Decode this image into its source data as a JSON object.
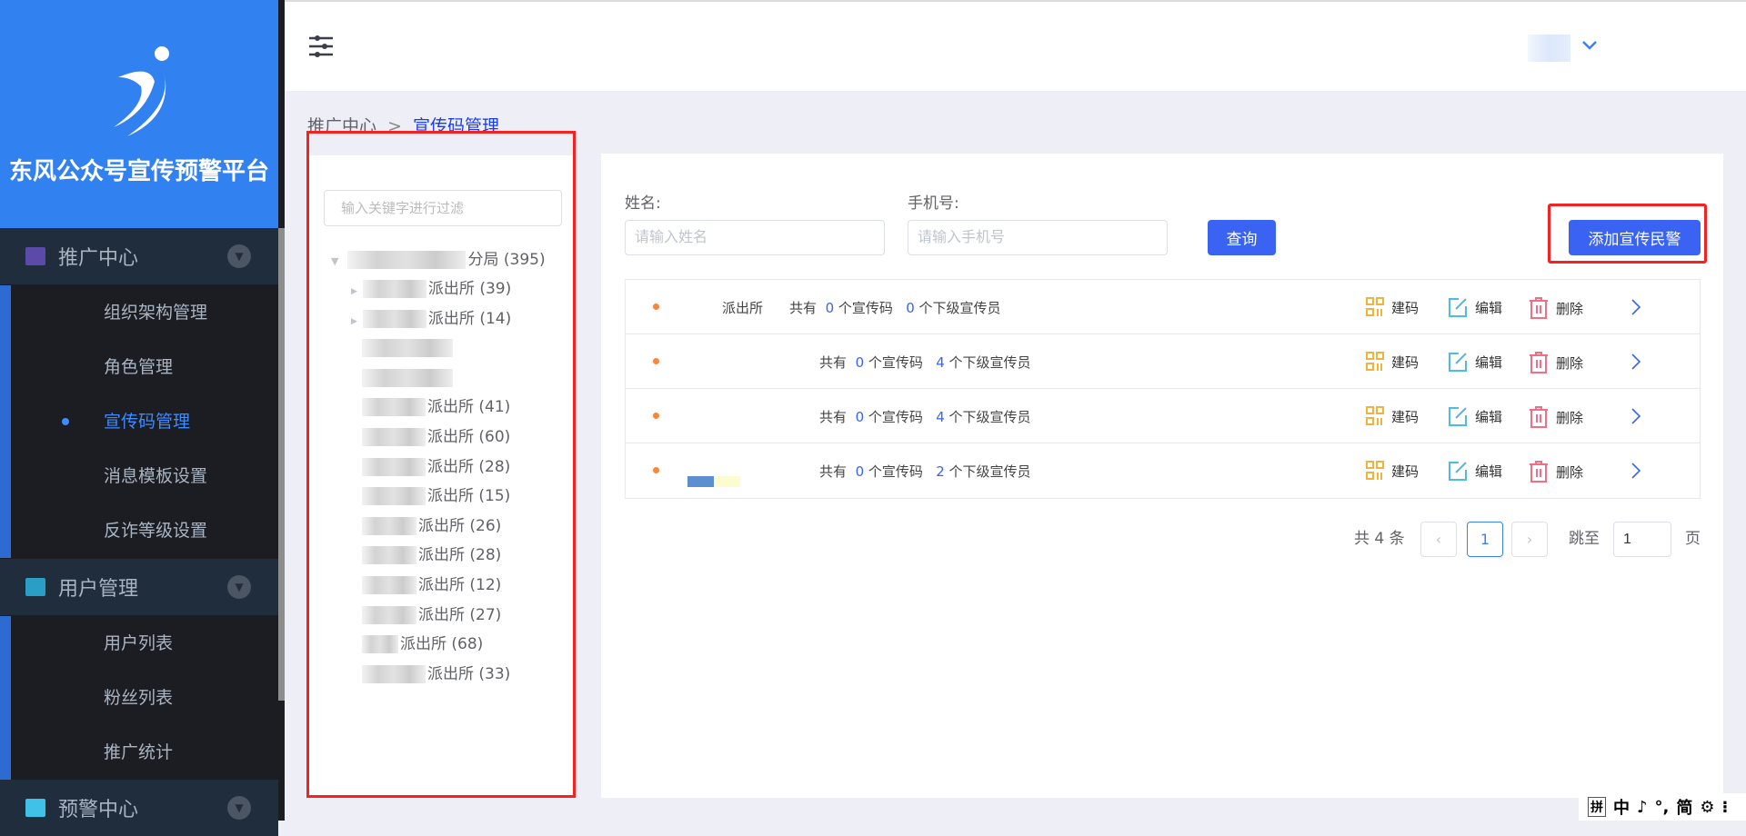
{
  "app": {
    "title": "东风公众号宣传预警平台"
  },
  "sidebar": {
    "groups": [
      {
        "label": "推广中心",
        "items": [
          "组织架构管理",
          "角色管理",
          "宣传码管理",
          "消息模板设置",
          "反诈等级设置"
        ],
        "active": 2
      },
      {
        "label": "用户管理",
        "items": [
          "用户列表",
          "粉丝列表",
          "推广统计"
        ]
      },
      {
        "label": "预警中心",
        "items": []
      }
    ]
  },
  "breadcrumb": {
    "parent": "推广中心",
    "separator": ">",
    "current": "宣传码管理"
  },
  "tree": {
    "filter_placeholder": "输入关键字进行过滤",
    "root": "分局 (395)",
    "children": [
      "派出所 (39)",
      "派出所 (14)",
      "",
      "",
      "派出所 (41)",
      "派出所 (60)",
      "派出所 (28)",
      "派出所 (15)",
      "派出所 (26)",
      "派出所 (28)",
      "派出所 (12)",
      "派出所 (27)",
      "派出所 (68)",
      "派出所 (33)"
    ]
  },
  "search": {
    "name_label": "姓名:",
    "name_placeholder": "请输入姓名",
    "phone_label": "手机号:",
    "phone_placeholder": "请输入手机号",
    "query_button": "查询",
    "add_button": "添加宣传民警"
  },
  "list": {
    "rows": [
      {
        "name": "派出所",
        "prefix": "共有",
        "codes": "0",
        "codes_suffix": "个宣传码",
        "subs": "0",
        "subs_suffix": "个下级宣传员"
      },
      {
        "name": "",
        "prefix": "共有",
        "codes": "0",
        "codes_suffix": "个宣传码",
        "subs": "4",
        "subs_suffix": "个下级宣传员"
      },
      {
        "name": "",
        "prefix": "共有",
        "codes": "0",
        "codes_suffix": "个宣传码",
        "subs": "4",
        "subs_suffix": "个下级宣传员"
      },
      {
        "name": "",
        "prefix": "共有",
        "codes": "0",
        "codes_suffix": "个宣传码",
        "subs": "2",
        "subs_suffix": "个下级宣传员"
      }
    ],
    "actions": {
      "qr": "建码",
      "edit": "编辑",
      "delete": "删除"
    }
  },
  "pagination": {
    "total": "共 4 条",
    "prev": "‹",
    "current": "1",
    "next": "›",
    "goto_label": "跳至",
    "goto_value": "1",
    "page_suffix": "页"
  },
  "ime": {
    "items": [
      "拼",
      "中",
      "♪",
      "°,",
      "简",
      "⚙",
      "⁝"
    ]
  },
  "colors": {
    "brand": "#3281f0",
    "primary": "#3a63f3",
    "sidebar": "#1c1d22",
    "highlight": "#f52222"
  }
}
